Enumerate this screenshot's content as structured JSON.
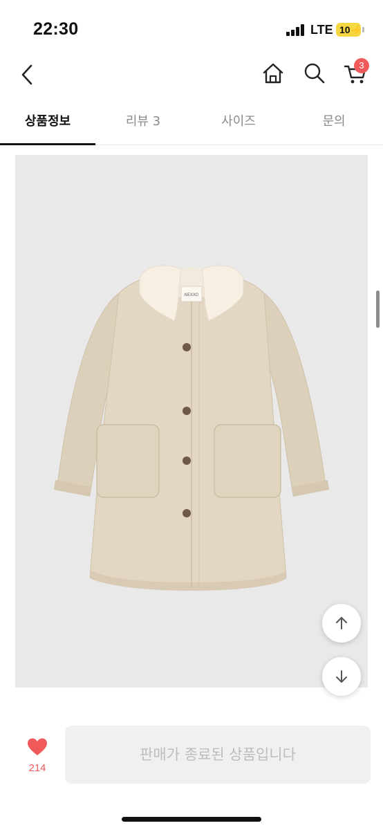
{
  "status_bar": {
    "time": "22:30",
    "network": "LTE",
    "battery": "10"
  },
  "header": {
    "back_icon": "chevron-left-icon",
    "home_icon": "home-icon",
    "search_icon": "search-icon",
    "cart_icon": "cart-icon",
    "cart_count": "3"
  },
  "tabs": [
    {
      "label": "상품정보",
      "active": true
    },
    {
      "label": "리뷰 3",
      "active": false
    },
    {
      "label": "사이즈",
      "active": false
    },
    {
      "label": "문의",
      "active": false
    }
  ],
  "product": {
    "image_subject": "beige coat with shearling collar",
    "brand_tag": "NEXXO"
  },
  "floating": {
    "up_icon": "arrow-up-icon",
    "down_icon": "arrow-down-icon"
  },
  "bottom": {
    "like_icon": "heart-icon",
    "like_count": "214",
    "status_button": "판매가 종료된 상품입니다"
  },
  "colors": {
    "accent": "#f05a5a",
    "coat": "#e3d7c3",
    "collar": "#f6efe2",
    "image_bg": "#e9e9ea"
  }
}
